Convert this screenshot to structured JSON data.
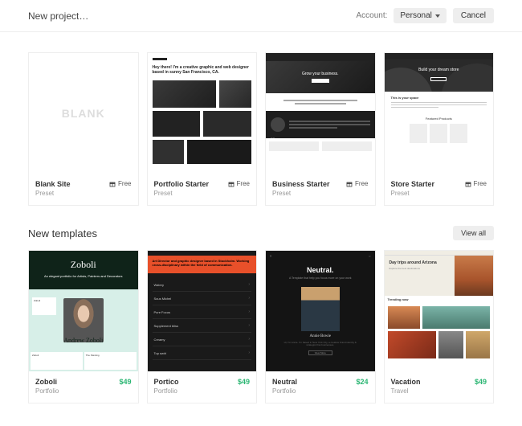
{
  "header": {
    "title": "New project…",
    "account_label": "Account:",
    "account_value": "Personal",
    "cancel": "Cancel"
  },
  "presets": [
    {
      "name": "Blank Site",
      "category": "Preset",
      "badge": "Free",
      "thumb_text": "BLANK"
    },
    {
      "name": "Portfolio Starter",
      "category": "Preset",
      "badge": "Free",
      "tagline": "Hey there! I'm a creative graphic and web designer based in sunny San Francisco, CA."
    },
    {
      "name": "Business Starter",
      "category": "Preset",
      "badge": "Free",
      "hero": "Grow your business.",
      "copy": "Grow your business, establish your brand, and put your customers first.",
      "who": "Who we are"
    },
    {
      "name": "Store Starter",
      "category": "Preset",
      "badge": "Free",
      "hero": "Build your dream store",
      "space": "This is your space",
      "featured": "Featured Products"
    }
  ],
  "templates_section": {
    "title": "New templates",
    "view_all": "View all"
  },
  "templates": [
    {
      "name": "Zoboli",
      "category": "Portfolio",
      "price": "$49",
      "logo": "Zoboli",
      "tagline": "An elegant portfolio for Artists, Painters and Decorators",
      "artist": "Andrew Zoboli"
    },
    {
      "name": "Portico",
      "category": "Portfolio",
      "price": "$49",
      "tagline": "Art Director and graphic designer based in Stockholm. Working cross-disciplinary within the field of communication.",
      "items": [
        "Watery",
        "Sous Michel",
        "Pure Focus",
        "Supplement bliss",
        "Creamy",
        "Top swirl"
      ]
    },
    {
      "name": "Neutral",
      "category": "Portfolio",
      "price": "$24",
      "title": "Neutral.",
      "subtitle": "A Template that help you focus more on your work",
      "artist": "Annie Bowie",
      "button": "View More"
    },
    {
      "name": "Vacation",
      "category": "Travel",
      "price": "$49",
      "hero": "Day trips around Arizona",
      "trending": "Trending now"
    }
  ]
}
